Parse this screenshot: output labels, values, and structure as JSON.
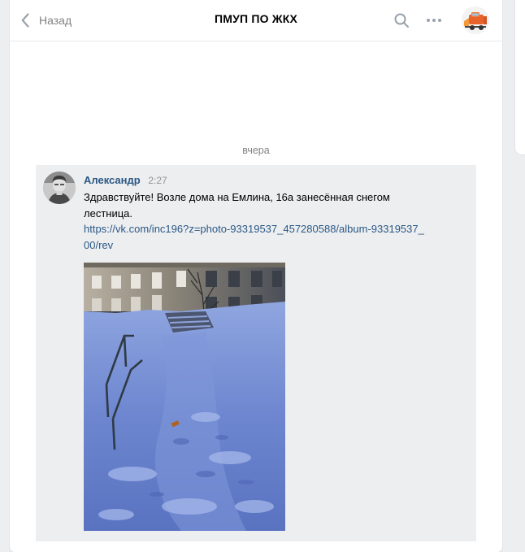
{
  "header": {
    "back_label": "Назад",
    "title": "ПМУП ПО ЖКХ"
  },
  "chat": {
    "date_separator": "вчера",
    "message": {
      "author": "Александр",
      "time": "2:27",
      "text": "Здравствуйте! Возле дома на Емлина, 16а занесённая снегом лестница.",
      "link": "https://vk.com/inc196?z=photo-93319537_457280588/album-93319537_00/rev"
    }
  },
  "icons": {
    "back": "chevron-left-icon",
    "search": "search-icon",
    "more": "more-dots-icon"
  },
  "colors": {
    "page_bg": "#edeef0",
    "link": "#2a5885",
    "muted": "#828282",
    "message_bg": "#edeef0"
  }
}
